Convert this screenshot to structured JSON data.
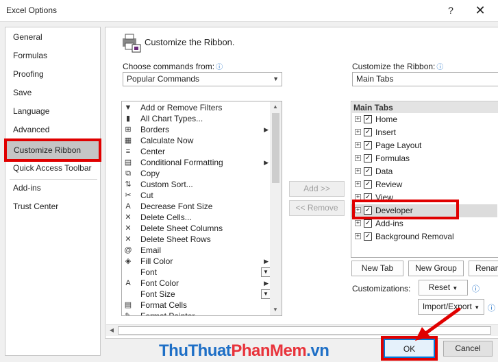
{
  "window": {
    "title": "Excel Options",
    "help": "?",
    "close": "✕"
  },
  "nav": {
    "items": [
      "General",
      "Formulas",
      "Proofing",
      "Save",
      "Language",
      "Advanced",
      "Customize Ribbon",
      "Quick Access Toolbar",
      "Add-ins",
      "Trust Center"
    ],
    "selected": "Customize Ribbon"
  },
  "header": {
    "title": "Customize the Ribbon."
  },
  "left_panel": {
    "label": "Choose commands from:",
    "selected": "Popular Commands",
    "commands": [
      {
        "label": "Add or Remove Filters",
        "icon": "filter-icon",
        "g": "▼"
      },
      {
        "label": "All Chart Types...",
        "icon": "chart-icon",
        "g": "▮"
      },
      {
        "label": "Borders",
        "icon": "borders-icon",
        "g": "⊞",
        "sub": true
      },
      {
        "label": "Calculate Now",
        "icon": "calculator-icon",
        "g": "▦"
      },
      {
        "label": "Center",
        "icon": "center-align-icon",
        "g": "≡"
      },
      {
        "label": "Conditional Formatting",
        "icon": "conditional-format-icon",
        "g": "▤",
        "sub": true
      },
      {
        "label": "Copy",
        "icon": "copy-icon",
        "g": "⧉"
      },
      {
        "label": "Custom Sort...",
        "icon": "sort-icon",
        "g": "⇅"
      },
      {
        "label": "Cut",
        "icon": "scissors-icon",
        "g": "✂"
      },
      {
        "label": "Decrease Font Size",
        "icon": "decrease-font-icon",
        "g": "A"
      },
      {
        "label": "Delete Cells...",
        "icon": "delete-cells-icon",
        "g": "✕"
      },
      {
        "label": "Delete Sheet Columns",
        "icon": "delete-columns-icon",
        "g": "✕"
      },
      {
        "label": "Delete Sheet Rows",
        "icon": "delete-rows-icon",
        "g": "✕"
      },
      {
        "label": "Email",
        "icon": "email-icon",
        "g": "@"
      },
      {
        "label": "Fill Color",
        "icon": "fill-color-icon",
        "g": "◈",
        "sub": true
      },
      {
        "label": "Font",
        "icon": "font-icon",
        "g": "",
        "dd": true
      },
      {
        "label": "Font Color",
        "icon": "font-color-icon",
        "g": "A",
        "sub": true
      },
      {
        "label": "Font Size",
        "icon": "font-size-icon",
        "g": "",
        "dd": true
      },
      {
        "label": "Format Cells",
        "icon": "format-cells-icon",
        "g": "▤"
      },
      {
        "label": "Format Painter",
        "icon": "format-painter-icon",
        "g": "✎"
      }
    ]
  },
  "middle": {
    "add": "Add >>",
    "remove": "<< Remove"
  },
  "right_panel": {
    "label": "Customize the Ribbon:",
    "selected": "Main Tabs",
    "tree_header": "Main Tabs",
    "tabs": [
      {
        "label": "Home",
        "checked": true
      },
      {
        "label": "Insert",
        "checked": true
      },
      {
        "label": "Page Layout",
        "checked": true
      },
      {
        "label": "Formulas",
        "checked": true
      },
      {
        "label": "Data",
        "checked": true
      },
      {
        "label": "Review",
        "checked": true
      },
      {
        "label": "View",
        "checked": true
      },
      {
        "label": "Developer",
        "checked": true
      },
      {
        "label": "Add-ins",
        "checked": true
      },
      {
        "label": "Background Removal",
        "checked": true
      }
    ],
    "new_tab": "New Tab",
    "new_group": "New Group",
    "rename": "Rename...",
    "customizations_label": "Customizations:",
    "reset": "Reset",
    "import_export": "Import/Export"
  },
  "footer": {
    "ok": "OK",
    "cancel": "Cancel"
  },
  "watermark": {
    "part1": "ThuThuat",
    "part2": "PhanMem",
    "part3": ".vn"
  },
  "colors": {
    "highlight": "#e00000",
    "accent": "#1e6fc6"
  }
}
